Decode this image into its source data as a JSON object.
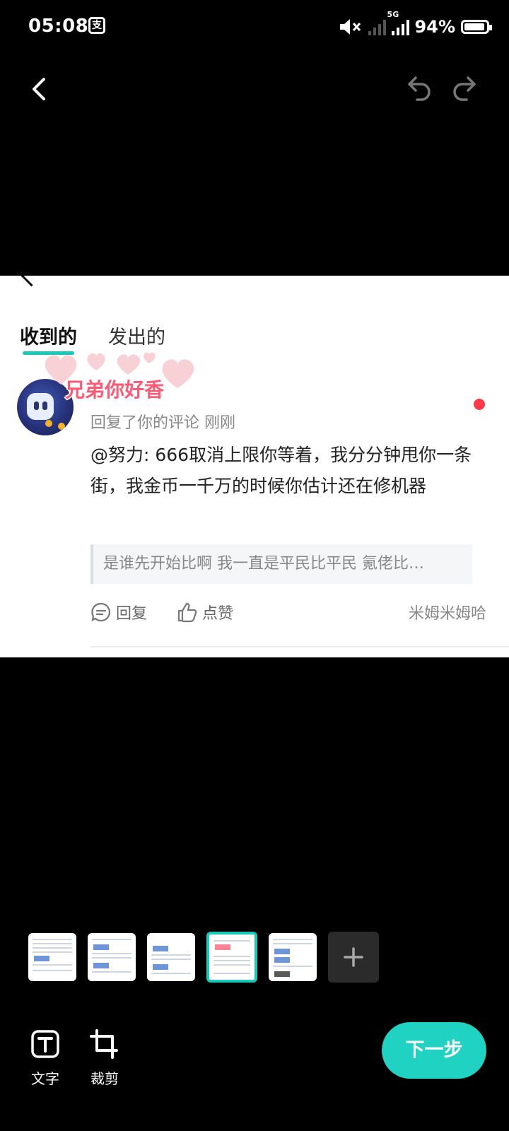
{
  "status_bar": {
    "time": "05:08",
    "network": "5G",
    "battery_percent": "94%",
    "battery_level": 0.94
  },
  "nav": {
    "back_icon": "chevron-left-icon",
    "undo_icon": "undo-icon",
    "redo_icon": "redo-icon"
  },
  "preview": {
    "tabs": [
      {
        "label": "收到的",
        "active": true
      },
      {
        "label": "发出的",
        "active": false
      }
    ],
    "username": "兄弟你好香",
    "meta": "回复了你的评论 刚刚",
    "comment": "@努力: 666取消上限你等着，我分分钟甩你一条街，我金币一千万的时候你估计还在修机器",
    "quote": "是谁先开始比啊  我一直是平民比平民  氪佬比…",
    "actions": {
      "reply": "回复",
      "like": "点赞"
    },
    "signature": "米姆米姆哈",
    "accent_color": "#19c9b8",
    "unread_color": "#ff3b48"
  },
  "thumbnails": {
    "count": 5,
    "selected_index": 4,
    "add_icon": "plus-icon"
  },
  "toolbar": {
    "text_label": "文字",
    "crop_label": "裁剪",
    "next_label": "下一步",
    "next_color": "#1fd2c1"
  }
}
